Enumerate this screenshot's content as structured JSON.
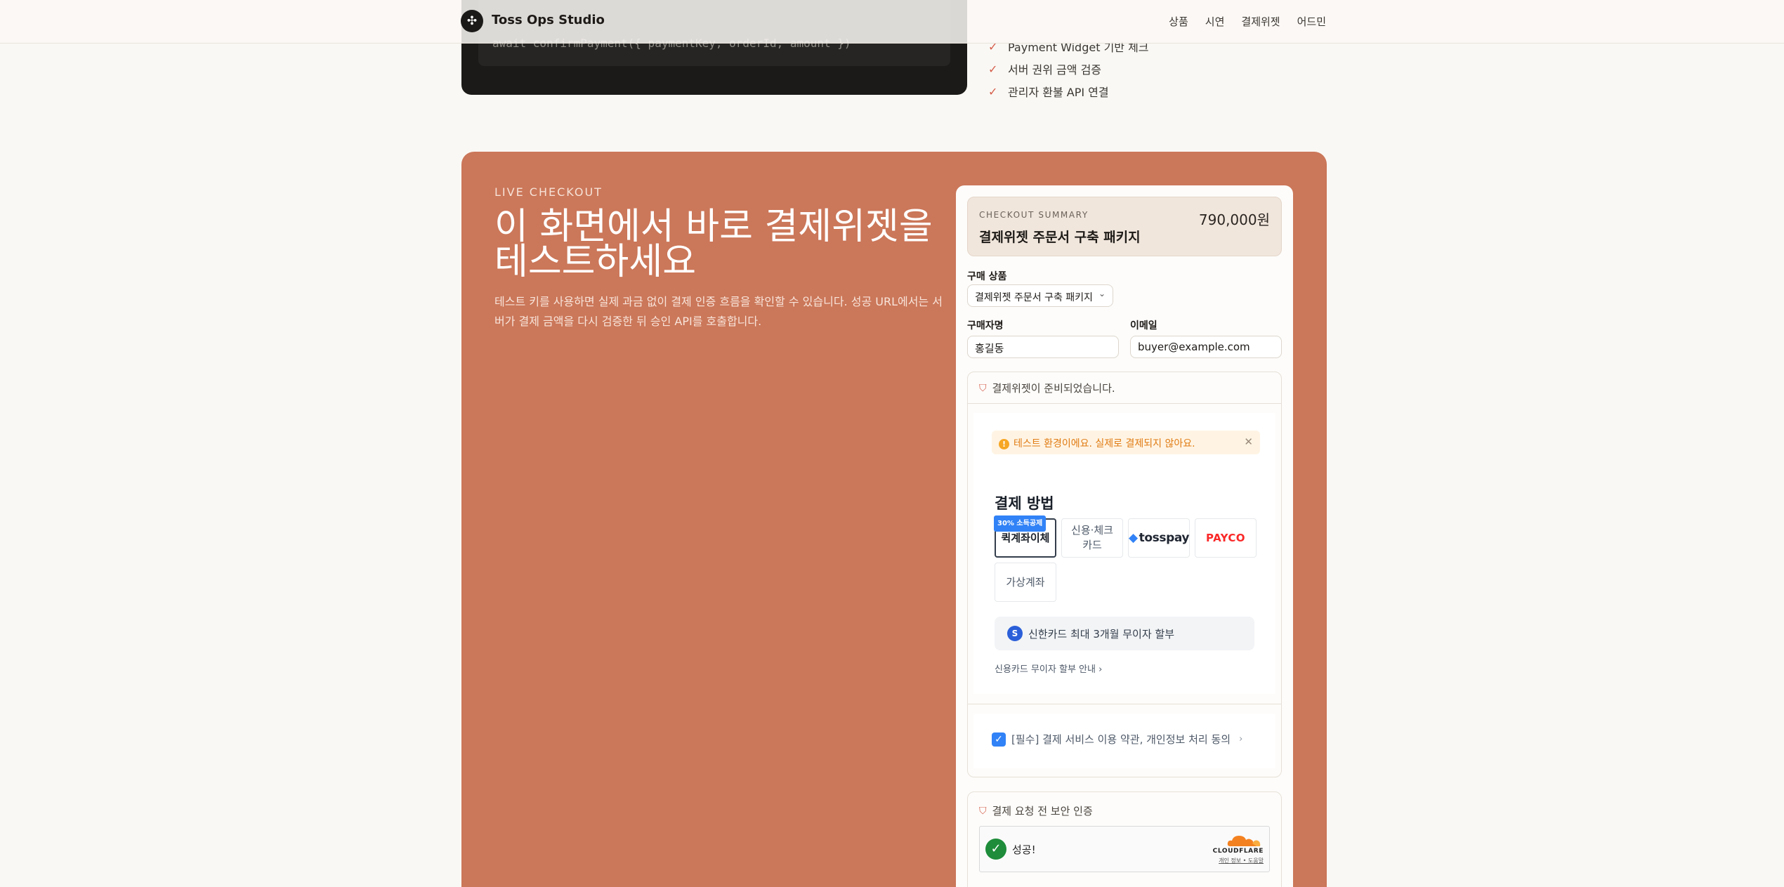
{
  "header": {
    "brand": "Toss Ops Studio",
    "nav": [
      "상품",
      "시연",
      "결제위젯",
      "어드민"
    ]
  },
  "top_context": {
    "code_line": "await confirmPayment({ paymentKey, orderId, amount })",
    "checklist": [
      "Payment Widget 기반 체크",
      "서버 권위 금액 검증",
      "관리자 환불 API 연결"
    ]
  },
  "live": {
    "eyebrow": "LIVE CHECKOUT",
    "title": "이 화면에서 바로 결제위젯을 테스트하세요",
    "description": "테스트 키를 사용하면 실제 과금 없이 결제 인증 흐름을 확인할 수 있습니다. 성공 URL에서는 서버가 결제 금액을 다시 검증한 뒤 승인 API를 호출합니다."
  },
  "checkout": {
    "summary_label": "CHECKOUT SUMMARY",
    "price": "790,000원",
    "product_title": "결제위젯 주문서 구축 패키지",
    "product_label": "구매 상품",
    "product_selected": "결제위젯 주문서 구축 패키지",
    "buyer_label": "구매자명",
    "buyer_value": "홍길동",
    "email_label": "이메일",
    "email_value": "buyer@example.com",
    "widget_status": "결제위젯이 준비되었습니다.",
    "verify_title": "결제 요청 전 보안 인증"
  },
  "widget": {
    "alert": "테스트 환경이에요. 실제로 결제되지 않아요.",
    "methods_title": "결제 방법",
    "methods": {
      "transfer_badge": "30% 소득공제",
      "transfer": "퀵계좌이체",
      "card": "신용·체크카드",
      "tosspay": "tosspay",
      "payco": "PAYCO",
      "virtual": "가상계좌"
    },
    "promo": "신한카드 최대 3개월 무이자 할부",
    "promo_link": "신용카드 무이자 할부 안내",
    "agreement": "[필수] 결제 서비스 이용 약관, 개인정보 처리 동의"
  },
  "turnstile": {
    "status": "성공!",
    "brand": "CLOUDFLARE",
    "links": "개인 정보 • 도움말"
  },
  "colors": {
    "accent_orange": "#cb7759",
    "toss_blue": "#3182f6",
    "success_green": "#1e8c3a"
  }
}
